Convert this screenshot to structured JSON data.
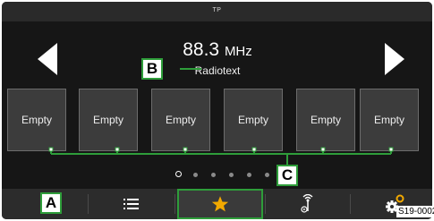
{
  "status_bar": {
    "tp": "TP"
  },
  "station": {
    "frequency": "88.3",
    "unit": "MHz",
    "radiotext": "Radiotext"
  },
  "presets": [
    "Empty",
    "Empty",
    "Empty",
    "Empty",
    "Empty",
    "Empty"
  ],
  "pager": {
    "pages": 6,
    "current": 1
  },
  "callouts": {
    "a": "A",
    "b": "B",
    "c": "C"
  },
  "bottom_nav": {
    "items": [
      {
        "icon": "menu-icon"
      },
      {
        "icon": "list-icon"
      },
      {
        "icon": "star-favorites-icon",
        "active": true
      },
      {
        "icon": "radio-antenna-icon"
      },
      {
        "icon": "settings-icon"
      }
    ]
  },
  "image_code": "S19-0002",
  "colors": {
    "callout_green": "#2e9d3a",
    "favorite_star": "#f2a900",
    "background": "#161616"
  }
}
